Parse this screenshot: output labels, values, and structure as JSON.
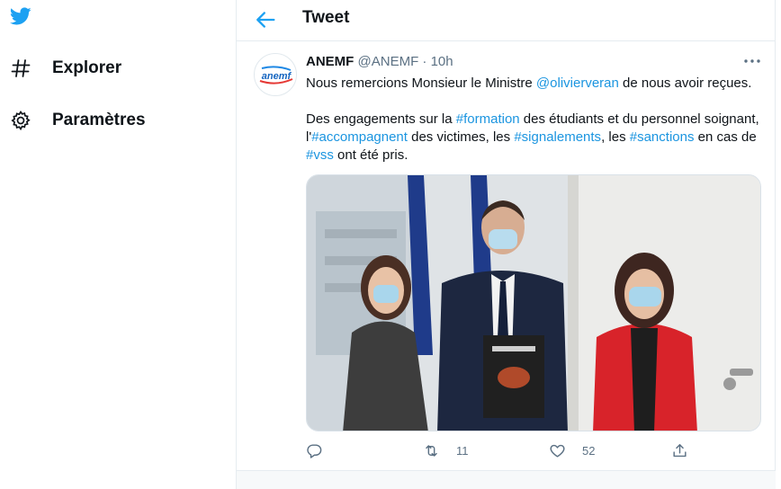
{
  "colors": {
    "brand": "#1DA1F2",
    "link": "#1B95E0",
    "muted": "#5B7083",
    "text": "#0F1419"
  },
  "sidebar": {
    "logo_icon": "twitter-bird-icon",
    "items": [
      {
        "label": "Explorer",
        "icon": "hashtag-icon"
      },
      {
        "label": "Paramètres",
        "icon": "gear-icon"
      }
    ]
  },
  "header": {
    "title": "Tweet",
    "back_icon": "arrow-left-icon"
  },
  "tweet": {
    "avatar_text": "anemf",
    "name": "ANEMF",
    "handle": "@ANEMF",
    "separator": "·",
    "time": "10h",
    "line1": {
      "before": "Nous remercions Monsieur le Ministre ",
      "mention": "@olivierveran",
      "after": " de nous avoir reçues."
    },
    "para2": {
      "p1": "Des engagements sur la ",
      "h1": "#formation",
      "p2": " des étudiants et du personnel soignant, l'",
      "h2": "#accompagnent",
      "p3": " des victimes, les ",
      "h3": "#signalements",
      "p4": ", les ",
      "h4": "#sanctions",
      "p5": " en cas de ",
      "h5": "#vss",
      "p6": " ont été pris."
    },
    "photo_icon": "photo-of-four-people-with-report",
    "actions": {
      "reply": {
        "icon": "reply-icon",
        "count": ""
      },
      "retweet": {
        "icon": "retweet-icon",
        "count": "11"
      },
      "like": {
        "icon": "heart-icon",
        "count": "52"
      },
      "share": {
        "icon": "share-icon",
        "count": ""
      }
    }
  }
}
